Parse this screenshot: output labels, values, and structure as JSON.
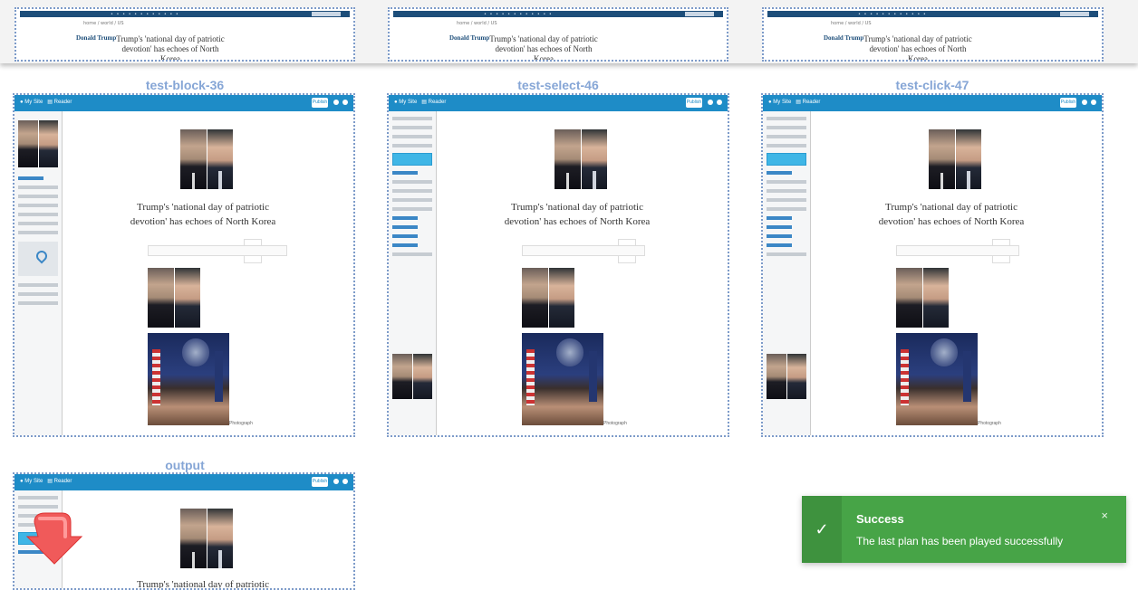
{
  "top_frames": [
    {
      "tag": "Donald Trump",
      "headline": "Trump's 'national day of patriotic devotion' has echoes of North Korea"
    },
    {
      "tag": "Donald Trump",
      "headline": "Trump's 'national day of patriotic devotion' has echoes of North Korea"
    },
    {
      "tag": "Donald Trump",
      "headline": "Trump's 'national day of patriotic devotion' has echoes of North Korea"
    }
  ],
  "panels": [
    {
      "title": "test-block-36",
      "headline": "Trump's 'national day of patriotic devotion' has echoes of North Korea"
    },
    {
      "title": "test-select-46",
      "headline": "Trump's 'national day of patriotic devotion' has echoes of North Korea"
    },
    {
      "title": "test-click-47",
      "headline": "Trump's 'national day of patriotic devotion' has echoes of North Korea"
    }
  ],
  "output": {
    "title": "output",
    "headline": "Trump's 'national day of patriotic"
  },
  "toast": {
    "title": "Success",
    "message": "The last plan has been played successfully",
    "close": "×",
    "check": "✓"
  },
  "colors": {
    "accent": "#1e8cc7",
    "toast": "#47a447",
    "frame_border": "#7d9bc9",
    "title": "#86a6d6"
  }
}
